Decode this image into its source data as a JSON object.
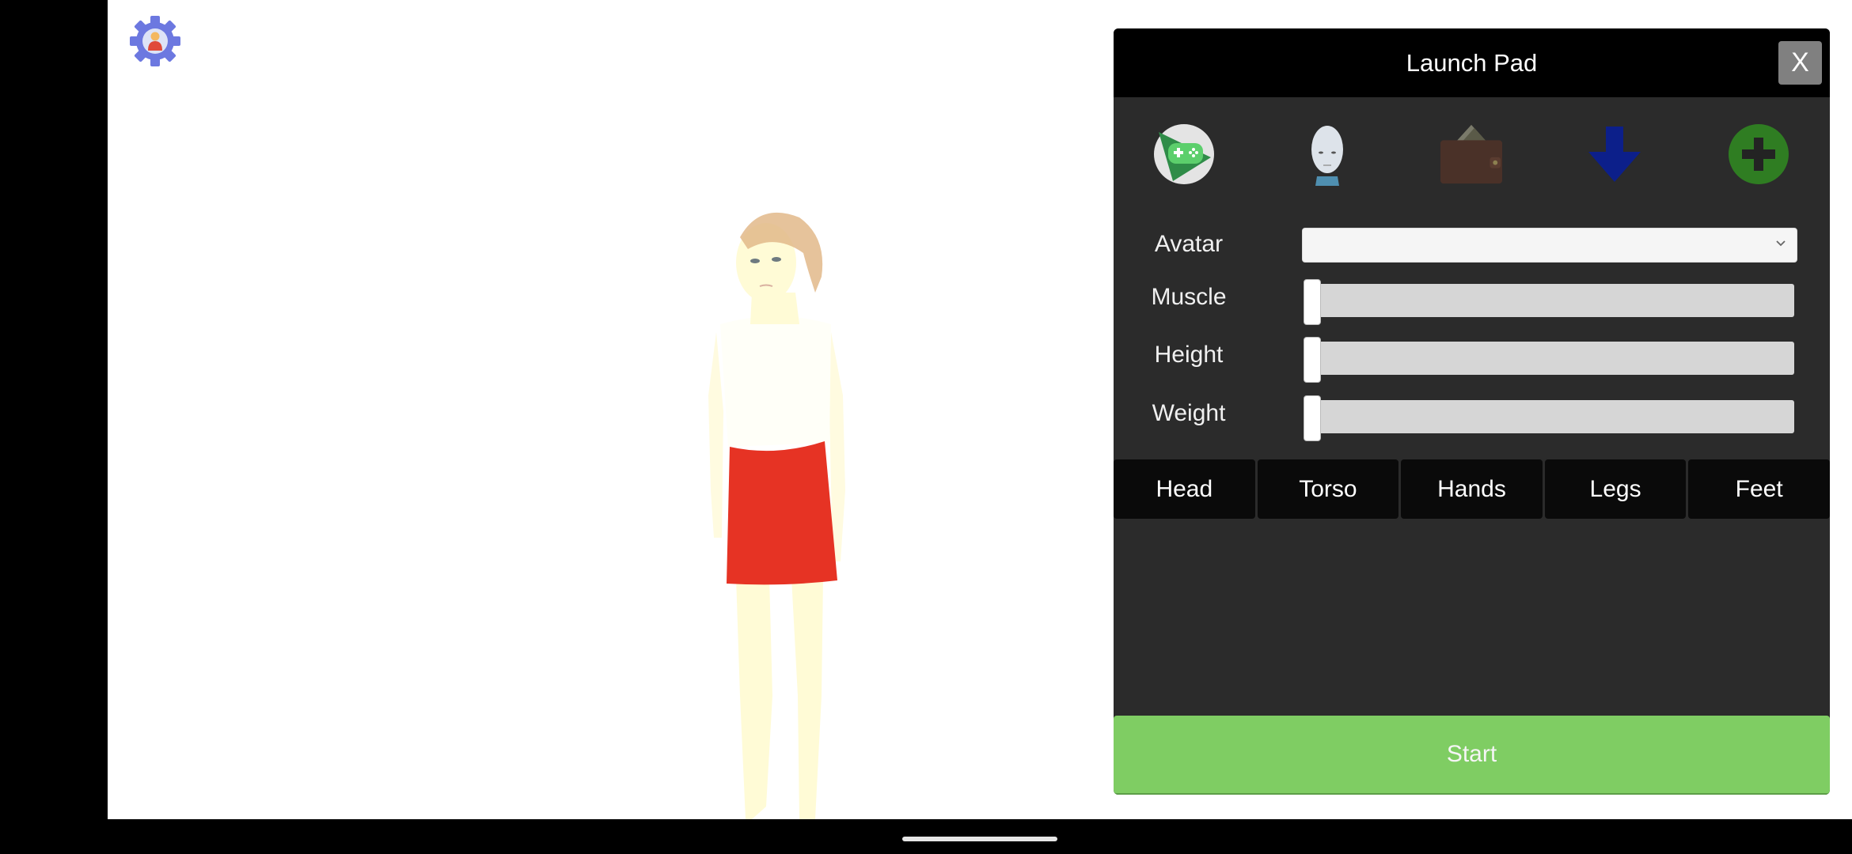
{
  "app": {
    "settings_icon": "settings-user-gear-icon"
  },
  "panel": {
    "title": "Launch Pad",
    "close_label": "X",
    "icons": [
      {
        "name": "game-controller-icon",
        "label": "Games"
      },
      {
        "name": "robot-head-icon",
        "label": "Avatar Head"
      },
      {
        "name": "wallet-icon",
        "label": "Wallet"
      },
      {
        "name": "download-arrow-icon",
        "label": "Download"
      },
      {
        "name": "add-plus-icon",
        "label": "Add"
      }
    ],
    "form": {
      "avatar": {
        "label": "Avatar",
        "value": ""
      },
      "muscle": {
        "label": "Muscle",
        "value": 0
      },
      "height": {
        "label": "Height",
        "value": 0
      },
      "weight": {
        "label": "Weight",
        "value": 0
      }
    },
    "tabs": [
      "Head",
      "Torso",
      "Hands",
      "Legs",
      "Feet"
    ],
    "start_label": "Start"
  },
  "colors": {
    "panel_bg": "#2b2b2b",
    "header_bg": "#000000",
    "start_green": "#7fcd63",
    "close_gray": "#808080",
    "skirt_red": "#e63324"
  }
}
